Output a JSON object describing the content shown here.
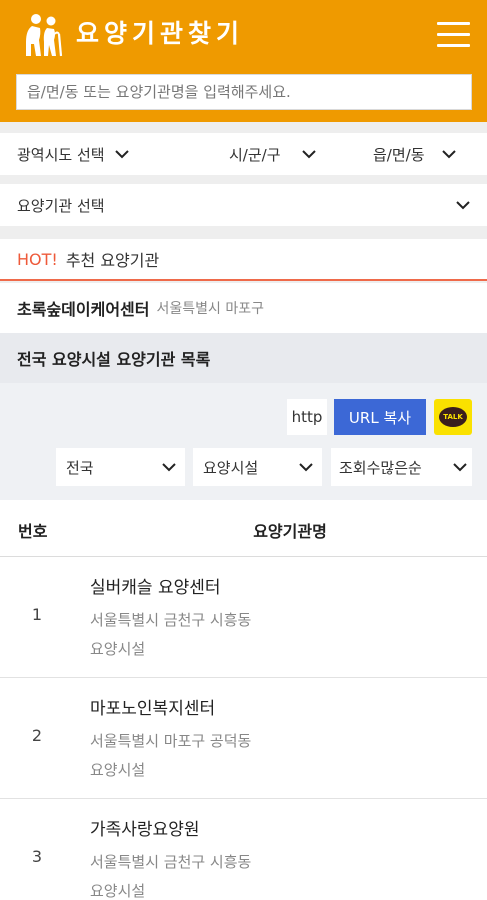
{
  "header": {
    "title": "요양기관찾기",
    "search_placeholder": "읍/면/동 또는 요양기관명을 입력해주세요."
  },
  "filters": {
    "province": "광역시도 선택",
    "city": "시/군/구",
    "town": "읍/면/동",
    "institution": "요양기관 선택"
  },
  "hot": {
    "tag": "HOT!",
    "title": "추천 요양기관",
    "item_name": "초록숲데이케어센터",
    "item_location": "서울특별시 마포구"
  },
  "list": {
    "heading": "전국 요양시설 요양기관 목록",
    "http_label": "http",
    "url_copy_label": "URL 복사",
    "kakao_label": "TALK",
    "region_filter": "전국",
    "type_filter": "요양시설",
    "sort_filter": "조회수많은순",
    "columns": {
      "number": "번호",
      "name": "요양기관명"
    },
    "rows": [
      {
        "no": "1",
        "name": "실버캐슬 요양센터",
        "address": "서울특별시 금천구 시흥동",
        "type": "요양시설"
      },
      {
        "no": "2",
        "name": "마포노인복지센터",
        "address": "서울특별시 마포구 공덕동",
        "type": "요양시설"
      },
      {
        "no": "3",
        "name": "가족사랑요양원",
        "address": "서울특별시 금천구 시흥동",
        "type": "요양시설"
      }
    ]
  },
  "colors": {
    "brand": "#ef9a00",
    "hot": "#ee5a3a",
    "url_button": "#3c68d6",
    "kakao": "#fae100"
  },
  "icons": [
    "elderly-couple-logo-icon",
    "hamburger-menu-icon",
    "chevron-down-icon",
    "kakaotalk-icon"
  ]
}
